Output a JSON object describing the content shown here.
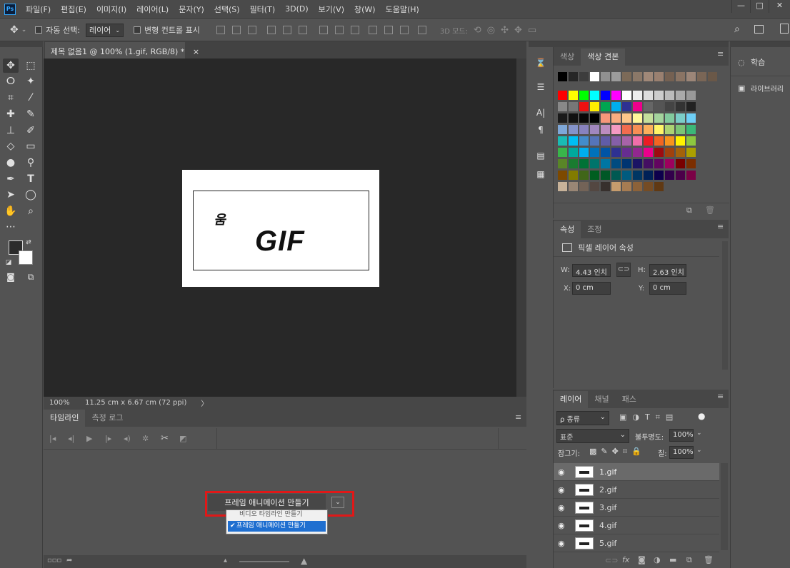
{
  "app": {
    "logo_text": "Ps"
  },
  "menubar": {
    "items": [
      "파일(F)",
      "편집(E)",
      "이미지(I)",
      "레이어(L)",
      "문자(Y)",
      "선택(S)",
      "필터(T)",
      "3D(D)",
      "보기(V)",
      "창(W)",
      "도움말(H)"
    ],
    "window_buttons": [
      "—",
      "□",
      "✕"
    ]
  },
  "options": {
    "auto_select_label": "자동 선택:",
    "auto_select_value": "레이어",
    "transform_label": "변형 컨트롤 표시",
    "three_d_mode": "3D 모드:"
  },
  "document": {
    "tab_title": "제목 없음1 @ 100% (1.gif, RGB/8) *",
    "close": "×",
    "canvas_small_text": "움",
    "canvas_big_text": "GIF"
  },
  "status": {
    "zoom": "100%",
    "doc_info": "11.25 cm x 6.67 cm (72 ppi)",
    "arrow": "〉"
  },
  "timeline": {
    "tabs": [
      "타임라인",
      "측정 로그"
    ],
    "create_button": "프레임 애니메이션 만들기",
    "options": [
      "비디오 타임라인 만들기",
      "프레임 애니메이션 만들기"
    ],
    "check": "✔"
  },
  "swatches": {
    "tabs": [
      "색상",
      "색상 견본"
    ],
    "rows": [
      [
        "#000000",
        "#262626",
        "#3d3d3d",
        "#ffffff",
        "#909090",
        "#9c9c9c",
        "#7c6a58",
        "#8b7868",
        "#a08878",
        "#9a8070",
        "#756152",
        "#8a7464",
        "#9c8678",
        "#7a6656",
        "#6a5848"
      ],
      [
        "#ff0000",
        "#ffff00",
        "#00ff00",
        "#00ffff",
        "#0000ff",
        "#ff00ff",
        "#ffffff",
        "#eeeeee",
        "#dddddd",
        "#cccccc",
        "#bbbbbb",
        "#aaaaaa",
        "#999999"
      ],
      [
        "#888888",
        "#777777",
        "#ee1111",
        "#ffee00",
        "#00a651",
        "#00aeef",
        "#2e3192",
        "#ec008c",
        "#666666",
        "#555555",
        "#444444",
        "#333333",
        "#222222"
      ],
      [
        "#1a1a1a",
        "#111111",
        "#080808",
        "#000000",
        "#f7977a",
        "#f9ad81",
        "#fdc68a",
        "#fff79a",
        "#c4df9b",
        "#a3d39c",
        "#82ca9d",
        "#7bcdc8",
        "#6ecff6"
      ],
      [
        "#7ea7d8",
        "#8493ca",
        "#8882be",
        "#a187be",
        "#bc8dbf",
        "#f49ac2",
        "#f26c4f",
        "#f68e55",
        "#fbaf5c",
        "#fff467",
        "#acd372",
        "#7cc576",
        "#3bb878"
      ],
      [
        "#1abbb4",
        "#00bff3",
        "#438cca",
        "#5574b9",
        "#605ca8",
        "#855fa8",
        "#a763a8",
        "#f06ea9",
        "#ed1c24",
        "#f26522",
        "#f7941d",
        "#fff200",
        "#8dc73f"
      ],
      [
        "#39b54a",
        "#00a99d",
        "#00aeef",
        "#0072bc",
        "#0054a6",
        "#2e3192",
        "#662d91",
        "#92278f",
        "#ec008c",
        "#9e0b0f",
        "#a0410d",
        "#a3620a",
        "#aba000"
      ],
      [
        "#598527",
        "#1a7b30",
        "#007236",
        "#00746b",
        "#0076a3",
        "#004b80",
        "#003471",
        "#1b1464",
        "#440e62",
        "#630460",
        "#9e005d",
        "#790000",
        "#7b2e00"
      ],
      [
        "#7d4900",
        "#827b00",
        "#406618",
        "#005e20",
        "#005826",
        "#005952",
        "#005b7f",
        "#003663",
        "#002157",
        "#0d004c",
        "#32004b",
        "#4b0049",
        "#7b0046"
      ],
      [
        "#c7b299",
        "#998675",
        "#736357",
        "#534741",
        "#37302d",
        "#c69c6d",
        "#a67c52",
        "#8c6239",
        "#754c24",
        "#603913"
      ]
    ]
  },
  "properties": {
    "tabs": [
      "속성",
      "조정"
    ],
    "title": "픽셀 레이어 속성",
    "w_label": "W:",
    "w": "4.43 인치",
    "h_label": "H:",
    "h": "2.63 인치",
    "x_label": "X:",
    "x": "0 cm",
    "y_label": "Y:",
    "y": "0 cm"
  },
  "layers": {
    "tabs": [
      "레이어",
      "채널",
      "패스"
    ],
    "filter": "ρ 종류",
    "blend": "표준",
    "opacity_label": "불투명도:",
    "opacity": "100%",
    "lock_label": "잠그기:",
    "fill_label": "칠:",
    "fill": "100%",
    "items": [
      "1.gif",
      "2.gif",
      "3.gif",
      "4.gif",
      "5.gif"
    ]
  },
  "right_panel": {
    "learn": "학습",
    "libraries": "라이브러리"
  }
}
